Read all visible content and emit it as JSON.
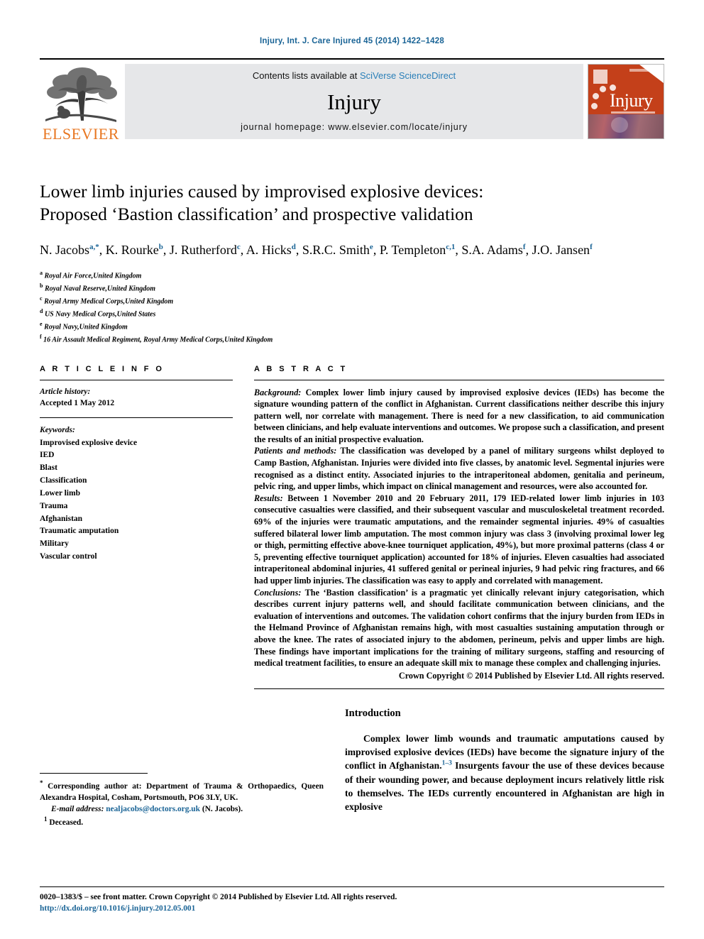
{
  "running_head": "Injury, Int. J. Care Injured 45 (2014) 1422–1428",
  "masthead": {
    "contents_prefix": "Contents lists available at",
    "sciencedirect_link": "SciVerse ScienceDirect",
    "journal_name": "Injury",
    "homepage": "journal homepage: www.elsevier.com/locate/injury",
    "publisher_wordmark": "ELSEVIER",
    "cover_title": "Injury"
  },
  "article": {
    "title_line1": "Lower limb injuries caused by improvised explosive devices:",
    "title_line2": "Proposed ‘Bastion classification’ and prospective validation",
    "authors_line1": "N. Jacobs",
    "authors_html": "N. Jacobs<sup>a,*</sup>, K. Rourke<sup>b</sup>, J. Rutherford<sup>c</sup>, A. Hicks<sup>d</sup>, S.R.C. Smith<sup>e</sup>, P. Templeton<sup>c,1</sup>, S.A. Adams<sup>f</sup>, J.O. Jansen<sup>f</sup>",
    "affiliations": [
      {
        "marker": "a",
        "text": "Royal Air Force,United Kingdom"
      },
      {
        "marker": "b",
        "text": "Royal Naval Reserve,United Kingdom"
      },
      {
        "marker": "c",
        "text": "Royal Army Medical Corps,United Kingdom"
      },
      {
        "marker": "d",
        "text": "US Navy Medical Corps,United States"
      },
      {
        "marker": "e",
        "text": "Royal Navy,United Kingdom"
      },
      {
        "marker": "f",
        "text": "16 Air Assault Medical Regiment, Royal Army Medical Corps,United Kingdom"
      }
    ]
  },
  "article_info": {
    "heading": "A R T I C L E    I N F O",
    "history_label": "Article history:",
    "history_value": "Accepted 1 May 2012",
    "keywords_label": "Keywords:",
    "keywords": [
      "Improvised explosive device",
      "IED",
      "Blast",
      "Classification",
      "Lower limb",
      "Trauma",
      "Afghanistan",
      "Traumatic amputation",
      "Military",
      "Vascular control"
    ]
  },
  "abstract": {
    "heading": "A B S T R A C T",
    "sections": [
      {
        "label": "Background:",
        "text": "Complex lower limb injury caused by improvised explosive devices (IEDs) has become the signature wounding pattern of the conflict in Afghanistan. Current classifications neither describe this injury pattern well, nor correlate with management. There is need for a new classification, to aid communication between clinicians, and help evaluate interventions and outcomes. We propose such a classification, and present the results of an initial prospective evaluation."
      },
      {
        "label": "Patients and methods:",
        "text": "The classification was developed by a panel of military surgeons whilst deployed to Camp Bastion, Afghanistan. Injuries were divided into five classes, by anatomic level. Segmental injuries were recognised as a distinct entity. Associated injuries to the intraperitoneal abdomen, genitalia and perineum, pelvic ring, and upper limbs, which impact on clinical management and resources, were also accounted for."
      },
      {
        "label": "Results:",
        "text": "Between 1 November 2010 and 20 February 2011, 179 IED-related lower limb injuries in 103 consecutive casualties were classified, and their subsequent vascular and musculoskeletal treatment recorded. 69% of the injuries were traumatic amputations, and the remainder segmental injuries. 49% of casualties suffered bilateral lower limb amputation. The most common injury was class 3 (involving proximal lower leg or thigh, permitting effective above-knee tourniquet application, 49%), but more proximal patterns (class 4 or 5, preventing effective tourniquet application) accounted for 18% of injuries. Eleven casualties had associated intraperitoneal abdominal injuries, 41 suffered genital or perineal injuries, 9 had pelvic ring fractures, and 66 had upper limb injuries. The classification was easy to apply and correlated with management."
      },
      {
        "label": "Conclusions:",
        "text": "The ‘Bastion classification’ is a pragmatic yet clinically relevant injury categorisation, which describes current injury patterns well, and should facilitate communication between clinicians, and the evaluation of interventions and outcomes. The validation cohort confirms that the injury burden from IEDs in the Helmand Province of Afghanistan remains high, with most casualties sustaining amputation through or above the knee. The rates of associated injury to the abdomen, perineum, pelvis and upper limbs are high. These findings have important implications for the training of military surgeons, staffing and resourcing of medical treatment facilities, to ensure an adequate skill mix to manage these complex and challenging injuries."
      }
    ],
    "copyright": "Crown Copyright © 2014 Published by Elsevier Ltd. All rights reserved."
  },
  "introduction": {
    "heading": "Introduction",
    "paragraph_pre": "Complex lower limb wounds and traumatic amputations caused by improvised explosive devices (IEDs) have become the signature injury of the conflict in Afghanistan.",
    "citation": "1–3",
    "paragraph_post": "Insurgents favour the use of these devices because of their wounding power, and because deployment incurs relatively little risk to themselves. The IEDs currently encountered in Afghanistan are high in explosive"
  },
  "footnotes": {
    "corresponding_marker": "*",
    "corresponding_text": "Corresponding author at: Department of Trauma & Orthopaedics, Queen Alexandra Hospital, Cosham, Portsmouth, PO6 3LY, UK.",
    "email_label": "E-mail address:",
    "email": "nealjacobs@doctors.org.uk",
    "email_attrib": "(N. Jacobs).",
    "deceased_marker": "1",
    "deceased_text": "Deceased."
  },
  "page_footer": {
    "issn_line": "0020–1383/$ – see front matter. Crown Copyright © 2014 Published by Elsevier Ltd. All rights reserved.",
    "doi": "http://dx.doi.org/10.1016/j.injury.2012.05.001"
  },
  "colors": {
    "link_blue": "#1a6496",
    "elsevier_orange": "#E87722",
    "cover_orange": "#c4401a",
    "masthead_grey": "#e6e7e9"
  }
}
